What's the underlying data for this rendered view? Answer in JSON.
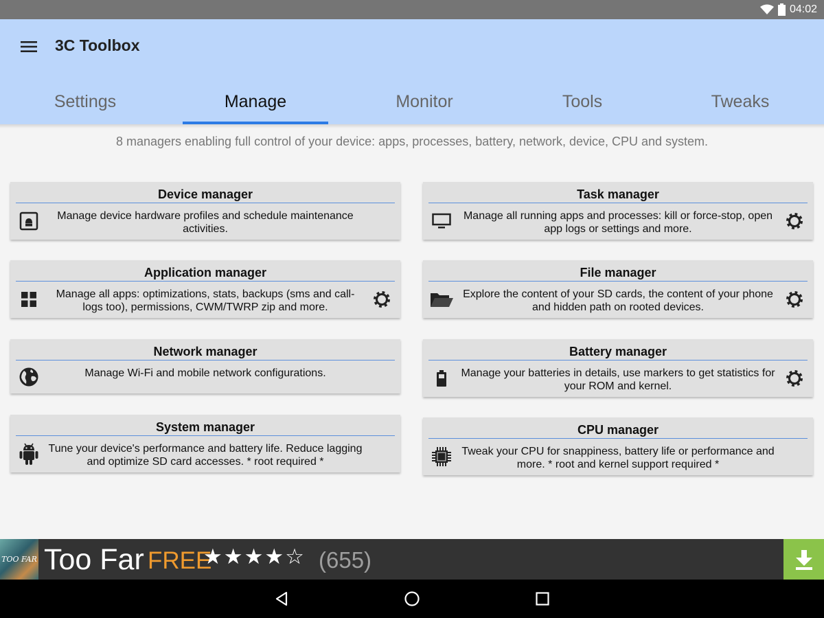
{
  "status_bar": {
    "time": "04:02",
    "icons": [
      "wifi-icon",
      "battery-icon"
    ]
  },
  "app_bar": {
    "title": "3C Toolbox",
    "menu_icon": "menu-icon",
    "tabs": [
      {
        "label": "Settings",
        "active": false
      },
      {
        "label": "Manage",
        "active": true
      },
      {
        "label": "Monitor",
        "active": false
      },
      {
        "label": "Tools",
        "active": false
      },
      {
        "label": "Tweaks",
        "active": false
      }
    ]
  },
  "subtitle": "8 managers enabling full control of your device: apps, processes, battery, network, device, CPU and system.",
  "managers": [
    {
      "title": "Device manager",
      "icon": "device-icon",
      "description": "Manage device hardware profiles and schedule maintenance activities.",
      "settings": false
    },
    {
      "title": "Task manager",
      "icon": "monitor-icon",
      "description": "Manage all running apps and processes: kill or force-stop, open app logs or settings and more.",
      "settings": true
    },
    {
      "title": "Application manager",
      "icon": "apps-grid-icon",
      "description": "Manage all apps: optimizations, stats, backups (sms and call-logs too), permissions, CWM/TWRP zip and more.",
      "settings": true
    },
    {
      "title": "File manager",
      "icon": "folder-icon",
      "description": "Explore the content of your SD cards, the content of your phone and hidden path on rooted devices.",
      "settings": true
    },
    {
      "title": "Network manager",
      "icon": "globe-icon",
      "description": "Manage Wi-Fi and mobile network configurations.",
      "settings": false
    },
    {
      "title": "Battery manager",
      "icon": "battery-icon",
      "description": "Manage your batteries in details, use markers to get statistics for your ROM and kernel.",
      "settings": true
    },
    {
      "title": "System manager",
      "icon": "android-icon",
      "description": "Tune your device's performance and battery life. Reduce lagging and optimize SD card accesses. * root required *",
      "settings": false
    },
    {
      "title": "CPU manager",
      "icon": "cpu-chip-icon",
      "description": "Tweak your CPU for snappiness, battery life or performance and more. * root and kernel support required *",
      "settings": false
    }
  ],
  "ad": {
    "thumbnail_text": "TOO FAR",
    "name": "Too Far",
    "price": "FREE",
    "rating": 4,
    "rating_max": 5,
    "stars_text": "★★★★☆",
    "review_count": "(655)",
    "download_icon": "download-icon",
    "colors": {
      "background": "#333333",
      "price": "#ef9a2e",
      "download": "#8bc34a"
    }
  },
  "nav_bar": {
    "buttons": [
      "back-icon",
      "home-icon",
      "recents-icon"
    ]
  },
  "colors": {
    "app_bar": "#bbd6fb",
    "tab_indicator": "#2c7be5",
    "card": "#e0e0e0",
    "card_rule": "#5b8fdc"
  }
}
